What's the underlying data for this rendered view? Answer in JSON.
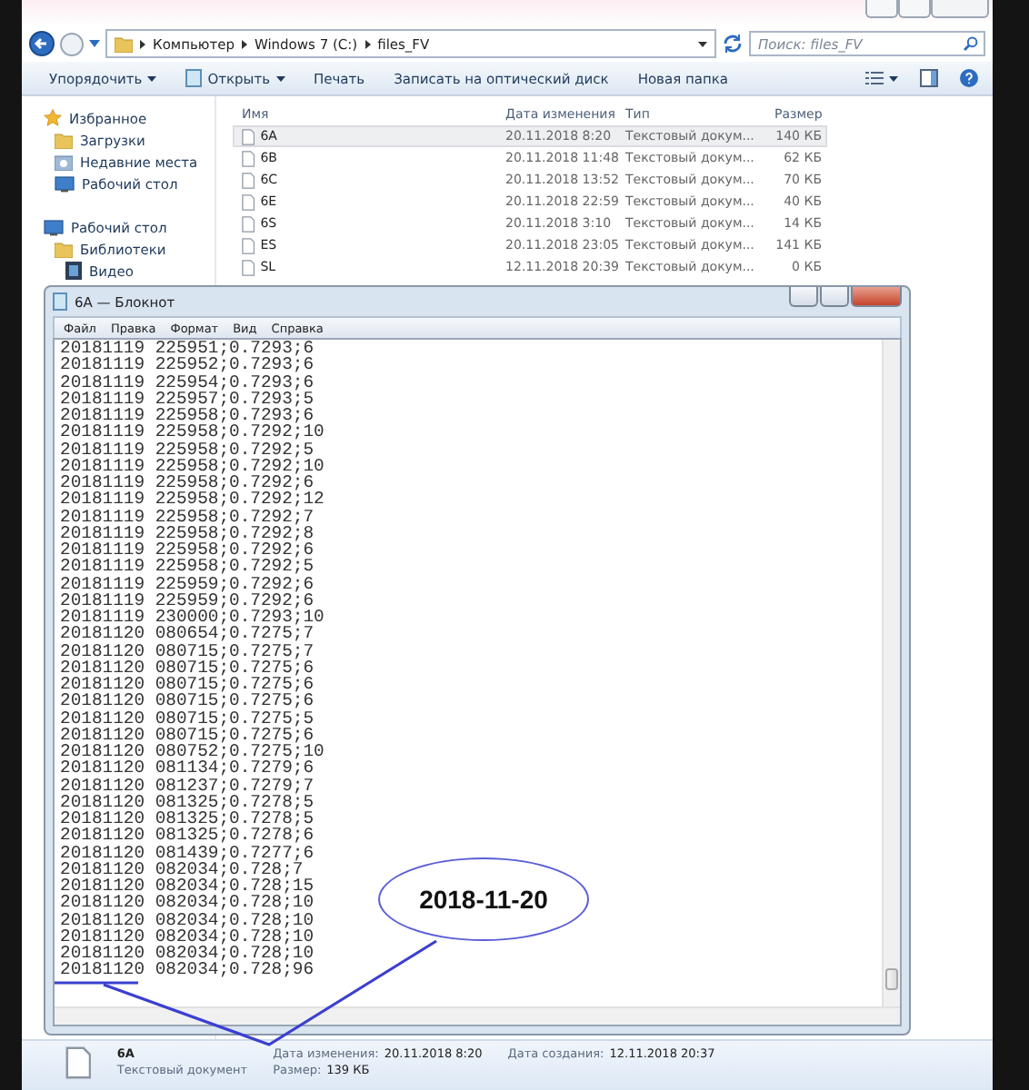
{
  "explorer": {
    "address": {
      "crumbs": [
        "Компьютер",
        "Windows 7 (C:)",
        "files_FV"
      ]
    },
    "search": {
      "placeholder": "Поиск: files_FV"
    },
    "toolbar": [
      {
        "label": "Упорядочить",
        "kind": "menu"
      },
      {
        "label": "Открыть",
        "kind": "open"
      },
      {
        "label": "Печать",
        "kind": "plain"
      },
      {
        "label": "Записать на оптический диск",
        "kind": "plain"
      },
      {
        "label": "Новая папка",
        "kind": "plain"
      }
    ],
    "sidebar": [
      {
        "label": "Избранное",
        "kind": "star",
        "children": [
          {
            "label": "Загрузки",
            "kind": "downloads"
          },
          {
            "label": "Недавние места",
            "kind": "recent"
          },
          {
            "label": "Рабочий стол",
            "kind": "desktop"
          }
        ]
      },
      {
        "label": "Рабочий стол",
        "kind": "desktop",
        "children": [
          {
            "label": "Библиотеки",
            "kind": "libraries",
            "children": [
              {
                "label": "Видео",
                "kind": "video"
              }
            ]
          }
        ]
      }
    ],
    "columns": [
      "Имя",
      "Дата изменения",
      "Тип",
      "Размер"
    ],
    "files": [
      {
        "name": "6A",
        "date": "20.11.2018 8:20",
        "type": "Текстовый докум...",
        "size": "140 КБ",
        "selected": true
      },
      {
        "name": "6B",
        "date": "20.11.2018 11:48",
        "type": "Текстовый докум...",
        "size": "62 КБ",
        "selected": false
      },
      {
        "name": "6C",
        "date": "20.11.2018 13:52",
        "type": "Текстовый докум...",
        "size": "70 КБ",
        "selected": false
      },
      {
        "name": "6E",
        "date": "20.11.2018 22:59",
        "type": "Текстовый докум...",
        "size": "40 КБ",
        "selected": false
      },
      {
        "name": "6S",
        "date": "20.11.2018 3:10",
        "type": "Текстовый докум...",
        "size": "14 КБ",
        "selected": false
      },
      {
        "name": "ES",
        "date": "20.11.2018 23:05",
        "type": "Текстовый докум...",
        "size": "141 КБ",
        "selected": false
      },
      {
        "name": "SL",
        "date": "12.11.2018 20:39",
        "type": "Текстовый докум...",
        "size": "0 КБ",
        "selected": false
      }
    ],
    "details": {
      "name": "6A",
      "type": "Текстовый документ",
      "fields": [
        {
          "label": "Дата изменения:",
          "value": "20.11.2018 8:20"
        },
        {
          "label": "Дата создания:",
          "value": "12.11.2018 20:37"
        },
        {
          "label": "Размер:",
          "value": "139 КБ"
        }
      ]
    }
  },
  "notepad": {
    "title": "6A — Блокнот",
    "menu": [
      "Файл",
      "Правка",
      "Формат",
      "Вид",
      "Справка"
    ],
    "lines": [
      "20181119 225951;0.7293;6",
      "20181119 225952;0.7293;6",
      "20181119 225954;0.7293;6",
      "20181119 225957;0.7293;5",
      "20181119 225958;0.7293;6",
      "20181119 225958;0.7292;10",
      "20181119 225958;0.7292;5",
      "20181119 225958;0.7292;10",
      "20181119 225958;0.7292;6",
      "20181119 225958;0.7292;12",
      "20181119 225958;0.7292;7",
      "20181119 225958;0.7292;8",
      "20181119 225958;0.7292;6",
      "20181119 225958;0.7292;5",
      "20181119 225959;0.7292;6",
      "20181119 225959;0.7292;6",
      "20181119 230000;0.7293;10",
      "20181120 080654;0.7275;7",
      "20181120 080715;0.7275;7",
      "20181120 080715;0.7275;6",
      "20181120 080715;0.7275;6",
      "20181120 080715;0.7275;6",
      "20181120 080715;0.7275;5",
      "20181120 080715;0.7275;6",
      "20181120 080752;0.7275;10",
      "20181120 081134;0.7279;6",
      "20181120 081237;0.7279;7",
      "20181120 081325;0.7278;5",
      "20181120 081325;0.7278;5",
      "20181120 081325;0.7278;6",
      "20181120 081439;0.7277;6",
      "20181120 082034;0.728;7",
      "20181120 082034;0.728;15",
      "20181120 082034;0.728;10",
      "20181120 082034;0.728;10",
      "20181120 082034;0.728;10",
      "20181120 082034;0.728;10",
      "20181120 082034;0.728;96"
    ]
  },
  "annotation": {
    "label": "2018-11-20"
  }
}
